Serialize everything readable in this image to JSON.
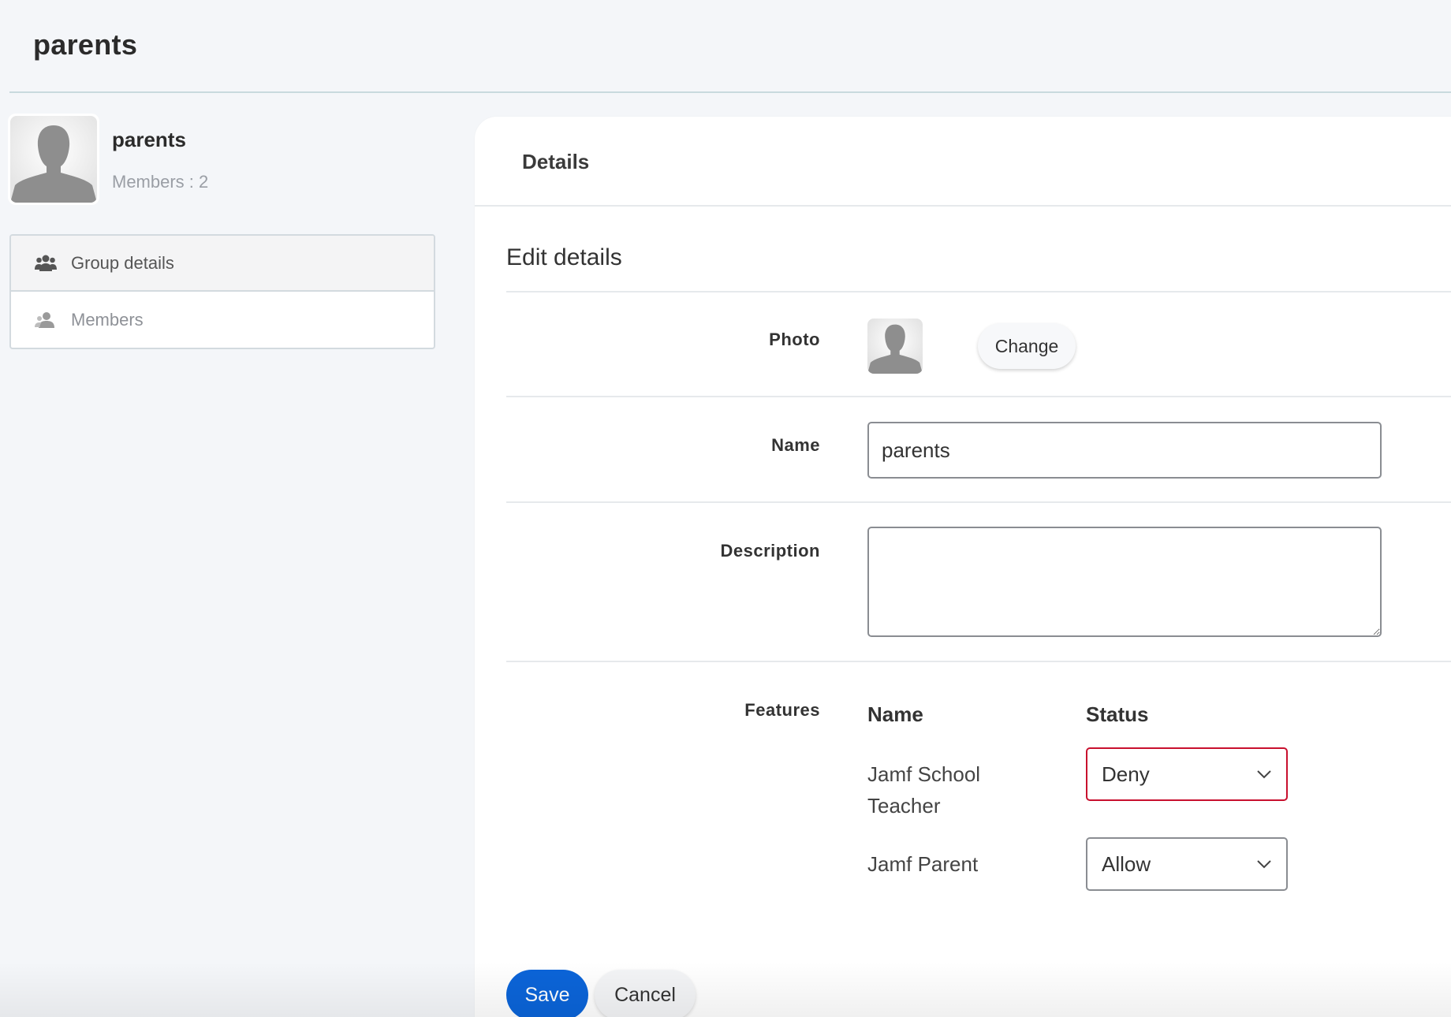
{
  "page": {
    "title": "parents"
  },
  "group": {
    "name": "parents",
    "members_label": "Members : 2",
    "avatar_icon": "person-silhouette-icon"
  },
  "sidebar": {
    "items": [
      {
        "label": "Group details",
        "icon": "group-icon",
        "active": true
      },
      {
        "label": "Members",
        "icon": "member-icon",
        "active": false
      }
    ]
  },
  "panel": {
    "header": "Details"
  },
  "form": {
    "section_title": "Edit details",
    "photo_label": "Photo",
    "change_label": "Change",
    "name_label": "Name",
    "name_value": "parents",
    "description_label": "Description",
    "description_value": "",
    "features_label": "Features",
    "features_col_name": "Name",
    "features_col_status": "Status",
    "features": [
      {
        "name": "Jamf School Teacher",
        "status": "Deny",
        "error": true
      },
      {
        "name": "Jamf Parent",
        "status": "Allow",
        "error": false
      }
    ]
  },
  "actions": {
    "save_label": "Save",
    "cancel_label": "Cancel"
  },
  "colors": {
    "primary": "#0b64d8",
    "error_border": "#c8102e",
    "background": "#f4f6f9"
  }
}
